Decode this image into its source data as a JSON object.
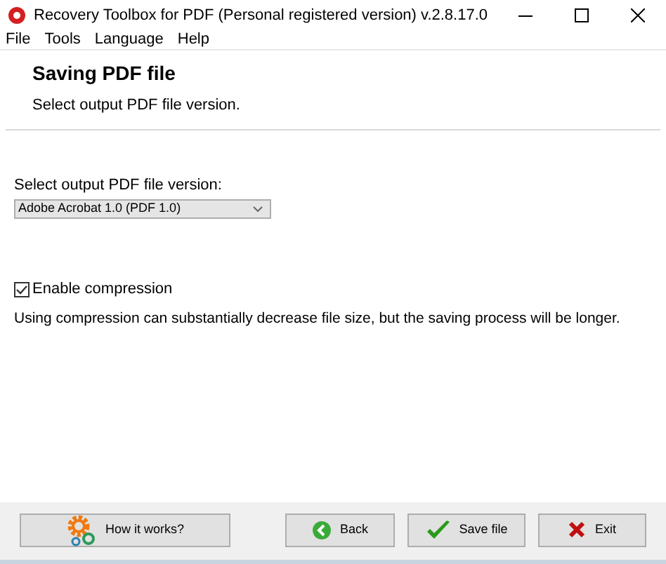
{
  "window": {
    "title": "Recovery Toolbox for PDF (Personal registered version) v.2.8.17.0"
  },
  "menu": [
    "File",
    "Tools",
    "Language",
    "Help"
  ],
  "header": {
    "title": "Saving PDF file",
    "subtitle": "Select output PDF file version."
  },
  "version": {
    "label": "Select output PDF file version:",
    "value": "Adobe Acrobat 1.0 (PDF 1.0)"
  },
  "compression": {
    "label": "Enable compression",
    "checked": true,
    "note": "Using compression can substantially decrease file size, but the saving process will be longer."
  },
  "buttons": [
    {
      "kind": "help",
      "label": "How it works?"
    },
    {
      "kind": "back",
      "label": "Back"
    },
    {
      "kind": "save",
      "label": "Save file"
    },
    {
      "kind": "exit",
      "label": "Exit"
    }
  ]
}
